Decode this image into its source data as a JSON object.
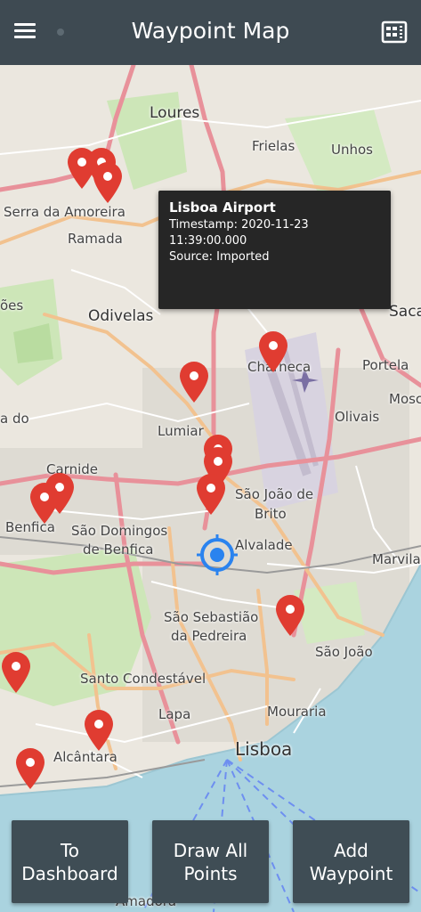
{
  "appbar": {
    "title": "Waypoint Map",
    "menu_icon": "hamburger-menu-icon",
    "action_icon": "ticket-icon"
  },
  "colors": {
    "appbar": "#3e4a52",
    "pin": "#e03c31",
    "location": "#2a83ef",
    "button": "#3f4d55",
    "popup": "#262626",
    "water": "#aad3df"
  },
  "map": {
    "places": [
      "Loures",
      "Frielas",
      "Unhos",
      "Serra da Amoreira",
      "Ramada",
      "Odivelas",
      "Sacav",
      "Charneca",
      "Portela",
      "Mosc",
      "Lumiar",
      "Olivais",
      "Carnide",
      "São João de",
      "Brito",
      "Benfica",
      "São Domingos",
      "de Benfica",
      "Alvalade",
      "Marvila",
      "São Sebastião",
      "da Pedreira",
      "São João",
      "Santo Condestável",
      "Lapa",
      "Mouraria",
      "Lisboa",
      "Alcântara",
      "Amadora",
      "ões",
      "a do"
    ]
  },
  "popup": {
    "title": "Lisboa Airport",
    "timestamp_line1": "Timestamp: 2020-11-23",
    "timestamp_line2": "11:39:00.000",
    "source": "Source: Imported"
  },
  "buttons": {
    "dashboard_line1": "To",
    "dashboard_line2": "Dashboard",
    "draw_line1": "Draw All",
    "draw_line2": "Points",
    "add_line1": "Add",
    "add_line2": "Waypoint"
  }
}
